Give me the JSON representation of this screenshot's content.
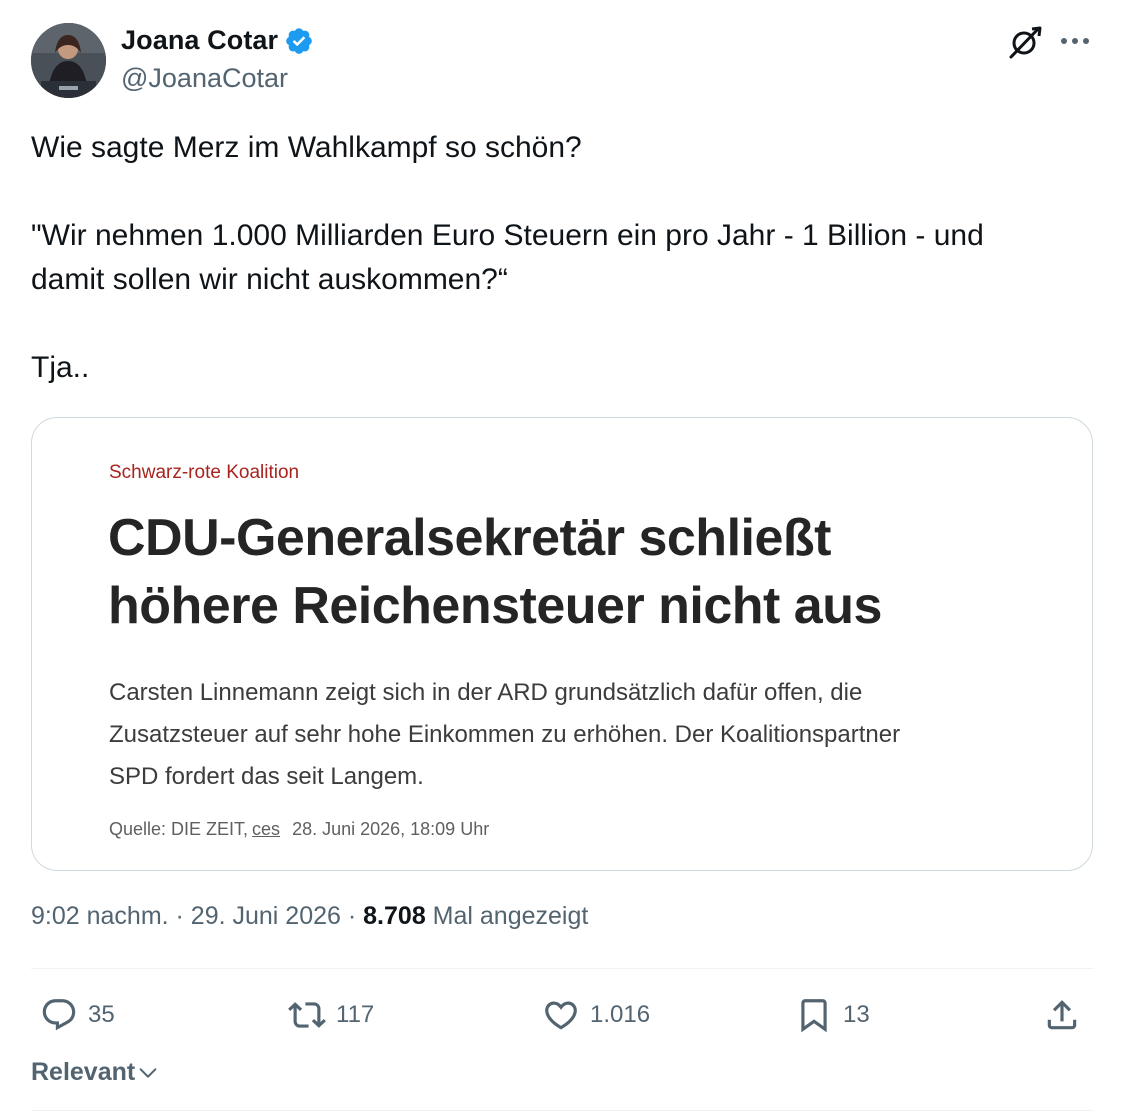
{
  "author": {
    "display_name": "Joana Cotar",
    "handle": "@JoanaCotar",
    "verified": true,
    "verified_color": "#1d9bf0",
    "avatar_icon": "avatar-photo"
  },
  "tweet": {
    "lines": [
      "Wie sagte Merz im Wahlkampf so schön?",
      "\"Wir nehmen 1.000 Milliarden Euro Steuern ein pro Jahr - 1 Billion - und",
      "damit sollen wir nicht auskommen?“",
      "Tja.."
    ]
  },
  "article": {
    "kicker": "Schwarz-rote Koalition",
    "headline_line1": "CDU-Generalsekretär schließt",
    "headline_line2": "höhere Reichensteuer nicht aus",
    "lede_line1": "Carsten Linnemann zeigt sich in der ARD grundsätzlich dafür offen, die",
    "lede_line2": "Zusatzsteuer auf sehr hohe Einkommen zu erhöhen. Der Koalitionspartner",
    "lede_line3": "SPD fordert das seit Langem.",
    "source_prefix": "Quelle: DIE ZEIT,",
    "source_author": "ces",
    "source_date": "28. Juni 2026, 18:09 Uhr",
    "kicker_color": "#a8231d"
  },
  "meta": {
    "time_date": "9:02 nachm. · 29. Juni 2026 · ",
    "views": "8.708",
    "views_label": " Mal angezeigt"
  },
  "actions": {
    "replies": "35",
    "reposts": "117",
    "likes": "1.016",
    "bookmarks": "13"
  },
  "sort": {
    "label": "Relevant"
  }
}
